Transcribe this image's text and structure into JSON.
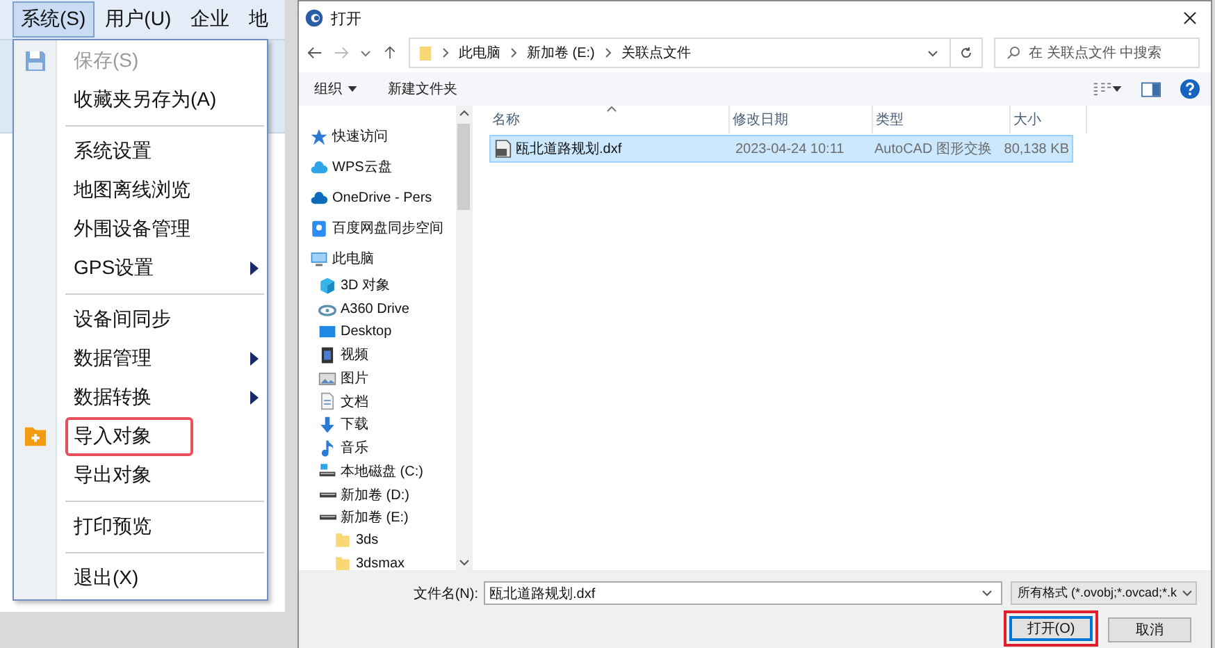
{
  "app": {
    "menubar": [
      {
        "label": "系统(S)",
        "selected": true
      },
      {
        "label": "用户(U)",
        "selected": false
      },
      {
        "label": "企业",
        "selected": false
      },
      {
        "label": "地",
        "selected": false
      }
    ],
    "menu": [
      {
        "kind": "save",
        "label": "保存(S)",
        "disabled": true,
        "submenu": false,
        "highlighted": false
      },
      {
        "kind": "plain",
        "label": "收藏夹另存为(A)",
        "disabled": false,
        "submenu": false,
        "highlighted": false
      },
      {
        "kind": "separator"
      },
      {
        "kind": "plain",
        "label": "系统设置",
        "disabled": false,
        "submenu": false,
        "highlighted": false
      },
      {
        "kind": "plain",
        "label": "地图离线浏览",
        "disabled": false,
        "submenu": false,
        "highlighted": false
      },
      {
        "kind": "plain",
        "label": "外围设备管理",
        "disabled": false,
        "submenu": false,
        "highlighted": false
      },
      {
        "kind": "plain",
        "label": "GPS设置",
        "disabled": false,
        "submenu": true,
        "highlighted": false
      },
      {
        "kind": "separator"
      },
      {
        "kind": "plain",
        "label": "设备间同步",
        "disabled": false,
        "submenu": false,
        "highlighted": false
      },
      {
        "kind": "plain",
        "label": "数据管理",
        "disabled": false,
        "submenu": true,
        "highlighted": false
      },
      {
        "kind": "plain",
        "label": "数据转换",
        "disabled": false,
        "submenu": true,
        "highlighted": false
      },
      {
        "kind": "import",
        "label": "导入对象",
        "disabled": false,
        "submenu": false,
        "highlighted": true
      },
      {
        "kind": "plain",
        "label": "导出对象",
        "disabled": false,
        "submenu": false,
        "highlighted": false
      },
      {
        "kind": "separator"
      },
      {
        "kind": "plain",
        "label": "打印预览",
        "disabled": false,
        "submenu": false,
        "highlighted": false
      },
      {
        "kind": "separator"
      },
      {
        "kind": "plain",
        "label": "退出(X)",
        "disabled": false,
        "submenu": false,
        "highlighted": false
      }
    ]
  },
  "dialog": {
    "title": "打开",
    "breadcrumb": [
      "此电脑",
      "新加卷 (E:)",
      "关联点文件"
    ],
    "search": {
      "placeholder": "在 关联点文件 中搜索"
    },
    "toolbar": [
      "组织",
      "新建文件夹"
    ],
    "tree": [
      {
        "kind": "star",
        "label": "快速访问"
      },
      {
        "kind": "cloud",
        "label": "WPS云盘"
      },
      {
        "kind": "onedrive",
        "label": "OneDrive - Pers"
      },
      {
        "kind": "baidu",
        "label": "百度网盘同步空间"
      },
      {
        "kind": "pc",
        "label": "此电脑",
        "children": [
          {
            "kind": "cube",
            "label": "3D 对象"
          },
          {
            "kind": "a360",
            "label": "A360 Drive"
          },
          {
            "kind": "desktop",
            "label": "Desktop"
          },
          {
            "kind": "video",
            "label": "视频"
          },
          {
            "kind": "picture",
            "label": "图片"
          },
          {
            "kind": "doc",
            "label": "文档"
          },
          {
            "kind": "download",
            "label": "下载"
          },
          {
            "kind": "music",
            "label": "音乐"
          },
          {
            "kind": "system-drive",
            "label": "本地磁盘 (C:)"
          },
          {
            "kind": "drive",
            "label": "新加卷 (D:)"
          },
          {
            "kind": "drive",
            "label": "新加卷 (E:)",
            "children": [
              {
                "kind": "folder",
                "label": "3ds"
              },
              {
                "kind": "folder",
                "label": "3dsmax"
              }
            ]
          }
        ]
      }
    ],
    "columns": [
      "名称",
      "修改日期",
      "类型",
      "大小"
    ],
    "files": [
      {
        "name": "瓯北道路规划.dxf",
        "modified": "2023-04-24 10:11",
        "type": "AutoCAD 图形交换",
        "size": "80,138 KB",
        "selected": true
      }
    ],
    "filename": {
      "label": "文件名(N):",
      "value": "瓯北道路规划.dxf"
    },
    "filetype": {
      "value": "所有格式 (*.ovobj;*.ovcad;*.k"
    },
    "buttons": [
      {
        "label": "打开(O)",
        "default": true,
        "highlighted": true
      },
      {
        "label": "取消",
        "default": false,
        "highlighted": false
      }
    ]
  }
}
